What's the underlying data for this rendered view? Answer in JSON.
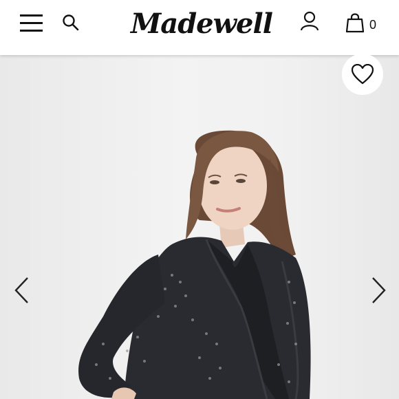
{
  "header": {
    "logo_text": "Madewell",
    "bag_count": "0",
    "icons": {
      "menu": "hamburger-menu-icon",
      "search": "search-icon",
      "account": "user-account-icon",
      "bag": "shopping-bag-icon"
    }
  },
  "product": {
    "favorite_icon": "heart-icon",
    "prev_icon": "chevron-left-icon",
    "next_icon": "chevron-right-icon"
  },
  "colors": {
    "header_bg": "#ffffff",
    "icon": "#111111",
    "photo_bg": "#efefef",
    "blouse": "#2a2b30"
  }
}
